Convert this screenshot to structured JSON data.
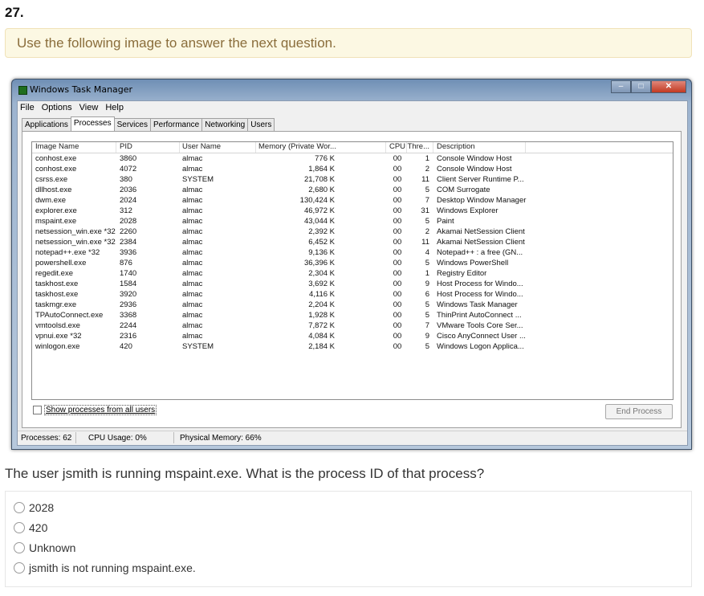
{
  "question_number": "27.",
  "instruction": "Use the following image to answer the next question.",
  "window": {
    "title": "Windows Task Manager",
    "menu": [
      "File",
      "Options",
      "View",
      "Help"
    ],
    "tabs": [
      "Applications",
      "Processes",
      "Services",
      "Performance",
      "Networking",
      "Users"
    ],
    "active_tab": "Processes",
    "columns": [
      "Image Name",
      "PID",
      "User Name",
      "Memory (Private Wor...",
      "CPU",
      "Thre...",
      "Description"
    ],
    "rows": [
      [
        "conhost.exe",
        "3860",
        "almac",
        "776 K",
        "00",
        "1",
        "Console Window Host"
      ],
      [
        "conhost.exe",
        "4072",
        "almac",
        "1,864 K",
        "00",
        "2",
        "Console Window Host"
      ],
      [
        "csrss.exe",
        "380",
        "SYSTEM",
        "21,708 K",
        "00",
        "11",
        "Client Server Runtime P..."
      ],
      [
        "dllhost.exe",
        "2036",
        "almac",
        "2,680 K",
        "00",
        "5",
        "COM Surrogate"
      ],
      [
        "dwm.exe",
        "2024",
        "almac",
        "130,424 K",
        "00",
        "7",
        "Desktop Window Manager"
      ],
      [
        "explorer.exe",
        "312",
        "almac",
        "46,972 K",
        "00",
        "31",
        "Windows Explorer"
      ],
      [
        "mspaint.exe",
        "2028",
        "almac",
        "43,044 K",
        "00",
        "5",
        "Paint"
      ],
      [
        "netsession_win.exe *32",
        "2260",
        "almac",
        "2,392 K",
        "00",
        "2",
        "Akamai NetSession Client"
      ],
      [
        "netsession_win.exe *32",
        "2384",
        "almac",
        "6,452 K",
        "00",
        "11",
        "Akamai NetSession Client"
      ],
      [
        "notepad++.exe *32",
        "3936",
        "almac",
        "9,136 K",
        "00",
        "4",
        "Notepad++ : a free (GN..."
      ],
      [
        "powershell.exe",
        "876",
        "almac",
        "36,396 K",
        "00",
        "5",
        "Windows PowerShell"
      ],
      [
        "regedit.exe",
        "1740",
        "almac",
        "2,304 K",
        "00",
        "1",
        "Registry Editor"
      ],
      [
        "taskhost.exe",
        "1584",
        "almac",
        "3,692 K",
        "00",
        "9",
        "Host Process for Windo..."
      ],
      [
        "taskhost.exe",
        "3920",
        "almac",
        "4,116 K",
        "00",
        "6",
        "Host Process for Windo..."
      ],
      [
        "taskmgr.exe",
        "2936",
        "almac",
        "2,204 K",
        "00",
        "5",
        "Windows Task Manager"
      ],
      [
        "TPAutoConnect.exe",
        "3368",
        "almac",
        "1,928 K",
        "00",
        "5",
        "ThinPrint AutoConnect ..."
      ],
      [
        "vmtoolsd.exe",
        "2244",
        "almac",
        "7,872 K",
        "00",
        "7",
        "VMware Tools Core Ser..."
      ],
      [
        "vpnui.exe *32",
        "2316",
        "almac",
        "4,084 K",
        "00",
        "9",
        "Cisco AnyConnect User ..."
      ],
      [
        "winlogon.exe",
        "420",
        "SYSTEM",
        "2,184 K",
        "00",
        "5",
        "Windows Logon Applica..."
      ]
    ],
    "show_all_label": "Show processes from all users",
    "end_process_label": "End Process",
    "status": {
      "processes": "Processes: 62",
      "cpu": "CPU Usage: 0%",
      "memory": "Physical Memory: 66%"
    }
  },
  "question": "The user jsmith is running mspaint.exe. What is the process ID of that process?",
  "answers": [
    "2028",
    "420",
    "Unknown",
    "jsmith is not running mspaint.exe."
  ]
}
